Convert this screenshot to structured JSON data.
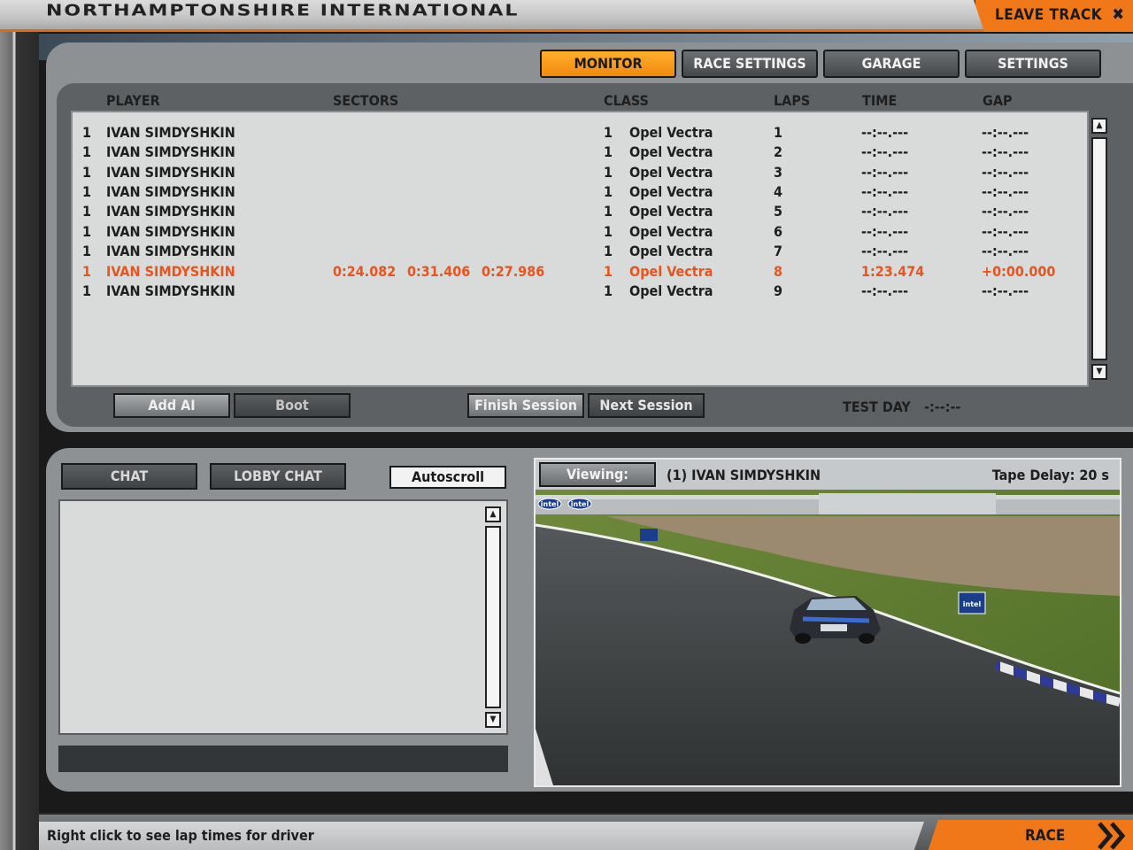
{
  "window": {
    "track_title": "NORTHAMPTONSHIRE INTERNATIONAL",
    "leave_track": "LEAVE TRACK"
  },
  "tabs": [
    {
      "label": "MONITOR",
      "active": true
    },
    {
      "label": "RACE SETTINGS",
      "active": false
    },
    {
      "label": "GARAGE",
      "active": false
    },
    {
      "label": "SETTINGS",
      "active": false
    }
  ],
  "results": {
    "headers": {
      "player": "PLAYER",
      "sectors": "SECTORS",
      "class": "CLASS",
      "laps": "LAPS",
      "time": "TIME",
      "gap": "GAP"
    },
    "rows": [
      {
        "pos": "1",
        "player": "IVAN SIMDYSHKIN",
        "s1": "",
        "s2": "",
        "s3": "",
        "class": "1",
        "car": "Opel Vectra",
        "laps": "1",
        "time": "--:--.---",
        "gap": "--:--.---",
        "highlight": false
      },
      {
        "pos": "1",
        "player": "IVAN SIMDYSHKIN",
        "s1": "",
        "s2": "",
        "s3": "",
        "class": "1",
        "car": "Opel Vectra",
        "laps": "2",
        "time": "--:--.---",
        "gap": "--:--.---",
        "highlight": false
      },
      {
        "pos": "1",
        "player": "IVAN SIMDYSHKIN",
        "s1": "",
        "s2": "",
        "s3": "",
        "class": "1",
        "car": "Opel Vectra",
        "laps": "3",
        "time": "--:--.---",
        "gap": "--:--.---",
        "highlight": false
      },
      {
        "pos": "1",
        "player": "IVAN SIMDYSHKIN",
        "s1": "",
        "s2": "",
        "s3": "",
        "class": "1",
        "car": "Opel Vectra",
        "laps": "4",
        "time": "--:--.---",
        "gap": "--:--.---",
        "highlight": false
      },
      {
        "pos": "1",
        "player": "IVAN SIMDYSHKIN",
        "s1": "",
        "s2": "",
        "s3": "",
        "class": "1",
        "car": "Opel Vectra",
        "laps": "5",
        "time": "--:--.---",
        "gap": "--:--.---",
        "highlight": false
      },
      {
        "pos": "1",
        "player": "IVAN SIMDYSHKIN",
        "s1": "",
        "s2": "",
        "s3": "",
        "class": "1",
        "car": "Opel Vectra",
        "laps": "6",
        "time": "--:--.---",
        "gap": "--:--.---",
        "highlight": false
      },
      {
        "pos": "1",
        "player": "IVAN SIMDYSHKIN",
        "s1": "",
        "s2": "",
        "s3": "",
        "class": "1",
        "car": "Opel Vectra",
        "laps": "7",
        "time": "--:--.---",
        "gap": "--:--.---",
        "highlight": false
      },
      {
        "pos": "1",
        "player": "IVAN SIMDYSHKIN",
        "s1": "0:24.082",
        "s2": "0:31.406",
        "s3": "0:27.986",
        "class": "1",
        "car": "Opel Vectra",
        "laps": "8",
        "time": "1:23.474",
        "gap": "+0:00.000",
        "highlight": true
      },
      {
        "pos": "1",
        "player": "IVAN SIMDYSHKIN",
        "s1": "",
        "s2": "",
        "s3": "",
        "class": "1",
        "car": "Opel Vectra",
        "laps": "9",
        "time": "--:--.---",
        "gap": "--:--.---",
        "highlight": false
      }
    ]
  },
  "actions": {
    "add_ai": "Add AI",
    "boot": "Boot",
    "finish_session": "Finish Session",
    "next_session": "Next Session",
    "session_label": "TEST DAY",
    "session_time": "-:--:--"
  },
  "chat": {
    "chat_tab": "CHAT",
    "lobby_chat_tab": "LOBBY CHAT",
    "autoscroll": "Autoscroll",
    "messages": [],
    "input_value": ""
  },
  "viewer": {
    "viewing_label": "Viewing:",
    "driver": "(1) IVAN SIMDYSHKIN",
    "tape_delay": "Tape Delay: 20 s",
    "sponsor_text": "intel"
  },
  "status_bar": {
    "hint": "Right click to see lap times for driver",
    "race_button": "RACE"
  },
  "colors": {
    "accent_orange": "#f07818",
    "highlight_red": "#e8541e",
    "panel_gray": "#8e9194",
    "list_bg": "#d8dbda"
  },
  "icons": {
    "close": "close-x-icon",
    "scroll_up": "scroll-up-arrow-icon",
    "scroll_down": "scroll-down-arrow-icon",
    "race_arrow": "chevron-right-double-icon"
  }
}
